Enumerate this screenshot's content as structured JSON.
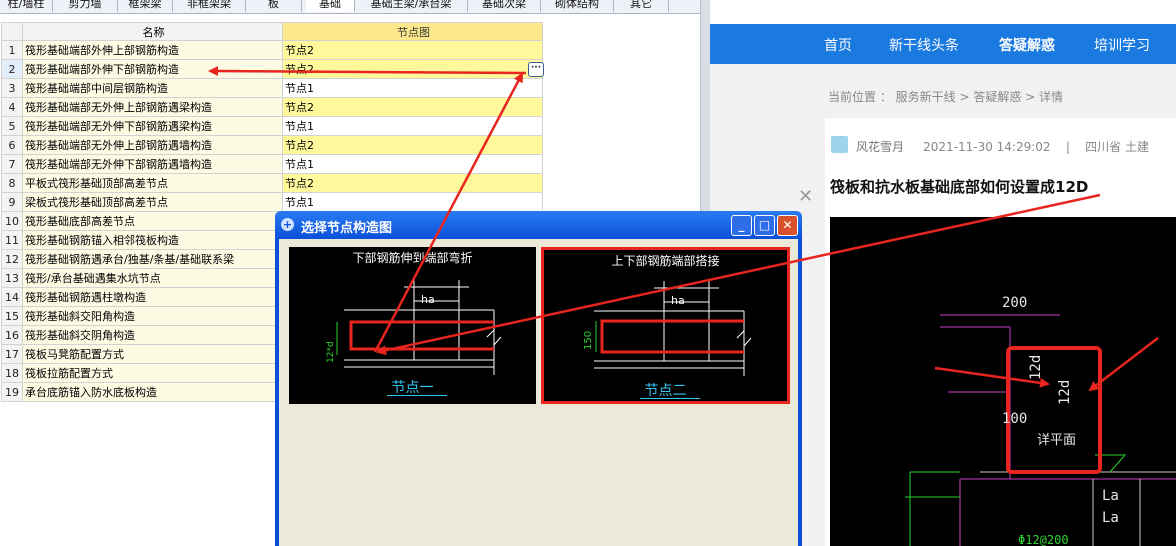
{
  "tabs": [
    "柱/墙柱",
    "剪力墙",
    "框架梁",
    "非框架梁",
    "板",
    "基础",
    "基础主梁/承台梁",
    "基础次梁",
    "砌体结构",
    "其它"
  ],
  "grid": {
    "headers": {
      "name": "名称",
      "node": "节点图"
    },
    "rows": [
      {
        "num": "1",
        "name": "筏形基础端部外伸上部钢筋构造",
        "node": "节点2"
      },
      {
        "num": "2",
        "name": "筏形基础端部外伸下部钢筋构造",
        "node": "节点2"
      },
      {
        "num": "3",
        "name": "筏形基础端部中间层钢筋构造",
        "node": "节点1"
      },
      {
        "num": "4",
        "name": "筏形基础端部无外伸上部钢筋遇梁构造",
        "node": "节点2"
      },
      {
        "num": "5",
        "name": "筏形基础端部无外伸下部钢筋遇梁构造",
        "node": "节点1"
      },
      {
        "num": "6",
        "name": "筏形基础端部无外伸上部钢筋遇墙构造",
        "node": "节点2"
      },
      {
        "num": "7",
        "name": "筏形基础端部无外伸下部钢筋遇墙构造",
        "node": "节点1"
      },
      {
        "num": "8",
        "name": "平板式筏形基础顶部高差节点",
        "node": "节点2"
      },
      {
        "num": "9",
        "name": "梁板式筏形基础顶部高差节点",
        "node": "节点1"
      },
      {
        "num": "10",
        "name": "筏形基础底部高差节点",
        "node": ""
      },
      {
        "num": "11",
        "name": "筏形基础钢筋锚入相邻筏板构造",
        "node": ""
      },
      {
        "num": "12",
        "name": "筏形基础钢筋遇承台/独基/条基/基础联系梁",
        "node": ""
      },
      {
        "num": "13",
        "name": "筏形/承台基础遇集水坑节点",
        "node": ""
      },
      {
        "num": "14",
        "name": "筏形基础钢筋遇柱墩构造",
        "node": ""
      },
      {
        "num": "15",
        "name": "筏形基础斜交阳角构造",
        "node": ""
      },
      {
        "num": "16",
        "name": "筏形基础斜交阴角构造",
        "node": ""
      },
      {
        "num": "17",
        "name": "筏板马凳筋配置方式",
        "node": ""
      },
      {
        "num": "18",
        "name": "筏板拉筋配置方式",
        "node": ""
      },
      {
        "num": "19",
        "name": "承台底筋锚入防水底板构造",
        "node": ""
      }
    ],
    "dots_label": "···"
  },
  "dialog": {
    "title": "选择节点构造图",
    "buttons": {
      "minimize": "_",
      "maximize": "□",
      "close": "✕"
    },
    "options": [
      {
        "title": "下部钢筋伸到端部弯折",
        "label": "节点一",
        "dim_top": "ha",
        "dim_side": "12*d"
      },
      {
        "title": "上下部钢筋端部搭接",
        "label": "节点二",
        "dim_top": "ha",
        "dim_side": "150"
      }
    ]
  },
  "web": {
    "nav": [
      "首页",
      "新干线头条",
      "答疑解惑",
      "培训学习"
    ],
    "breadcrumb": "当前位置 ： 服务新干线 > 答疑解惑 > 详情",
    "author": "风花雪月",
    "date": "2021-11-30 14:29:02",
    "separator": "|",
    "region": "四川省  土建",
    "title": "筏板和抗水板基础底部如何设置成12D",
    "close_symbol": "✕",
    "cad_labels": [
      "200",
      "12d",
      "12d",
      "100",
      "详平面",
      "La",
      "La",
      "Φ12@200"
    ]
  },
  "colors": {
    "accent_red": "#e8251e",
    "nav_blue": "#1b7ae0",
    "highlight_yellow": "#fff99c",
    "dialog_blue": "#0a4fd8"
  }
}
